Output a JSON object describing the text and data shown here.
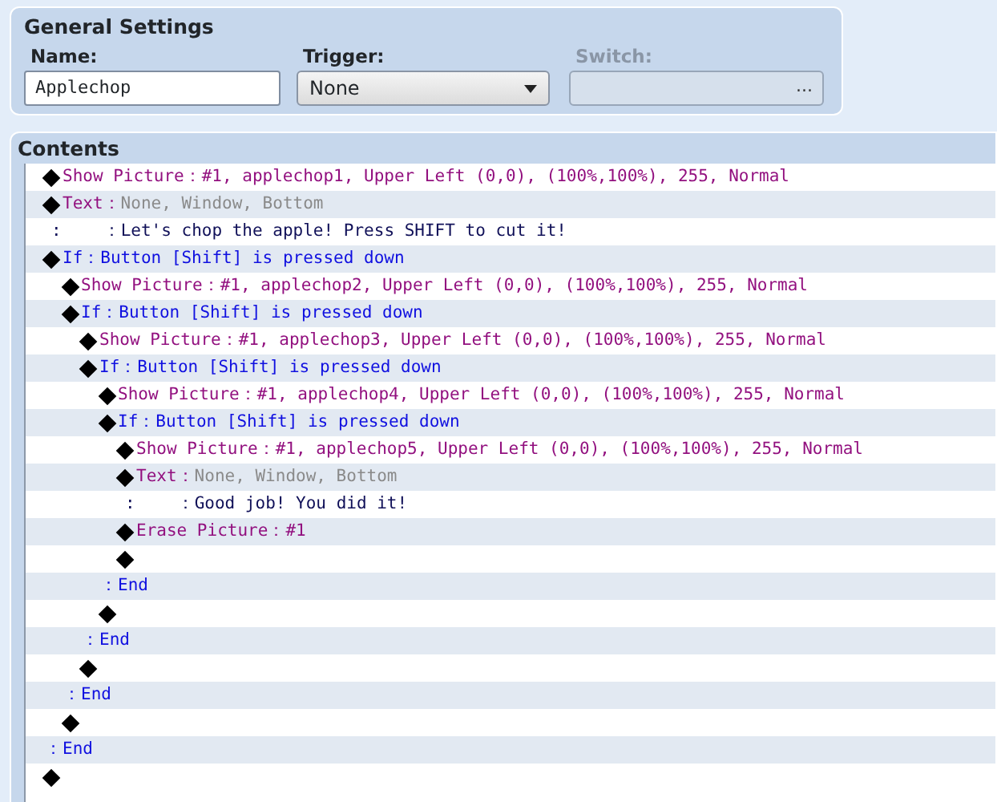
{
  "general_settings": {
    "title": "General Settings",
    "name": {
      "label": "Name:",
      "value": "Applechop"
    },
    "trigger": {
      "label": "Trigger:",
      "value": "None"
    },
    "switch": {
      "label": "Switch:",
      "disabled": true,
      "button": "..."
    }
  },
  "contents": {
    "title": "Contents",
    "commands": [
      {
        "kind": "picture",
        "label": "Show Picture：",
        "params": "#1, applechop1, Upper Left (0,0), (100%,100%), 255, Normal"
      },
      {
        "kind": "message",
        "label": "Text：",
        "params": "None, Window, Bottom"
      },
      {
        "kind": "message_line",
        "marker": ":",
        "text": "：Let's chop the apple! Press SHIFT to cut it!"
      },
      {
        "kind": "branch",
        "label": "If：",
        "params": "Button [Shift] is pressed down",
        "children": [
          {
            "kind": "picture",
            "label": "Show Picture：",
            "params": "#1, applechop2, Upper Left (0,0), (100%,100%), 255, Normal"
          },
          {
            "kind": "branch",
            "label": "If：",
            "params": "Button [Shift] is pressed down",
            "children": [
              {
                "kind": "picture",
                "label": "Show Picture：",
                "params": "#1, applechop3, Upper Left (0,0), (100%,100%), 255, Normal"
              },
              {
                "kind": "branch",
                "label": "If：",
                "params": "Button [Shift] is pressed down",
                "children": [
                  {
                    "kind": "picture",
                    "label": "Show Picture：",
                    "params": "#1, applechop4, Upper Left (0,0), (100%,100%), 255, Normal"
                  },
                  {
                    "kind": "branch",
                    "label": "If：",
                    "params": "Button [Shift] is pressed down",
                    "children": [
                      {
                        "kind": "picture",
                        "label": "Show Picture：",
                        "params": "#1, applechop5, Upper Left (0,0), (100%,100%), 255, Normal"
                      },
                      {
                        "kind": "message",
                        "label": "Text：",
                        "params": "None, Window, Bottom"
                      },
                      {
                        "kind": "message_line",
                        "marker": ":",
                        "text": "：Good job! You did it!"
                      },
                      {
                        "kind": "picture",
                        "label": "Erase Picture：",
                        "params": "#1"
                      },
                      {
                        "kind": "empty"
                      }
                    ]
                  },
                  {
                    "kind": "end",
                    "text": "：End"
                  },
                  {
                    "kind": "empty"
                  }
                ]
              },
              {
                "kind": "end",
                "text": "：End"
              },
              {
                "kind": "empty"
              }
            ]
          },
          {
            "kind": "end",
            "text": "：End"
          },
          {
            "kind": "empty"
          }
        ]
      },
      {
        "kind": "end",
        "text": "：End"
      },
      {
        "kind": "empty"
      }
    ]
  }
}
